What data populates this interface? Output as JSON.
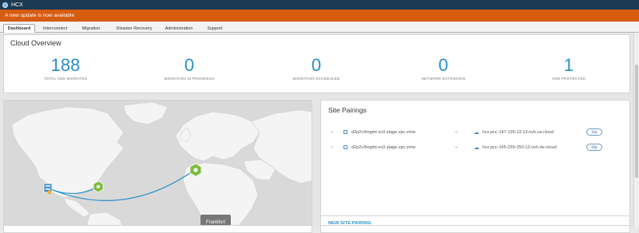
{
  "app": {
    "title": "HCX",
    "logo_icon": "hcx-logo-icon"
  },
  "banner": {
    "text": "A new update is now available",
    "color": "#d65c10"
  },
  "tabs": [
    {
      "label": "Dashboard",
      "active": true
    },
    {
      "label": "Interconnect",
      "active": false
    },
    {
      "label": "Migration",
      "active": false
    },
    {
      "label": "Disaster Recovery",
      "active": false
    },
    {
      "label": "Administration",
      "active": false
    },
    {
      "label": "Support",
      "active": false
    }
  ],
  "overview": {
    "title": "Cloud Overview",
    "stats": [
      {
        "value": "188",
        "label": "TOTAL VMS MIGRATED"
      },
      {
        "value": "0",
        "label": "MIGRATION IN PROGRESS"
      },
      {
        "value": "0",
        "label": "MIGRATION SCHEDULED"
      },
      {
        "value": "0",
        "label": "NETWORK EXTENSION"
      },
      {
        "value": "1",
        "label": "VMS PROTECTED"
      }
    ]
  },
  "map": {
    "tooltip": "Frankfurt",
    "accent": "#2a8fc9",
    "site_icons": [
      "datacenter-icon",
      "cloud-site-icon",
      "cloud-site-icon"
    ]
  },
  "pairings": {
    "title": "Site Pairings",
    "rows": [
      {
        "source": "d2p2v3mgmt-vc0.stage.vpc.vmw",
        "target": "hcx.pcc-147-135-13-13.ovh.us-cloud",
        "status": "Up"
      },
      {
        "source": "d2p2v3mgmt-vc0.stage.vpc.vmw",
        "target": "hcx.pcc-145-239-250-13.ovh.de-cloud",
        "status": "Up"
      }
    ],
    "new_pairing_label": "NEW SITE PAIRING"
  },
  "icons": {
    "expand": "chevron-right-icon",
    "vcenter": "vcenter-icon",
    "arrow": "arrow-right-icon",
    "cloud": "cloud-icon"
  }
}
